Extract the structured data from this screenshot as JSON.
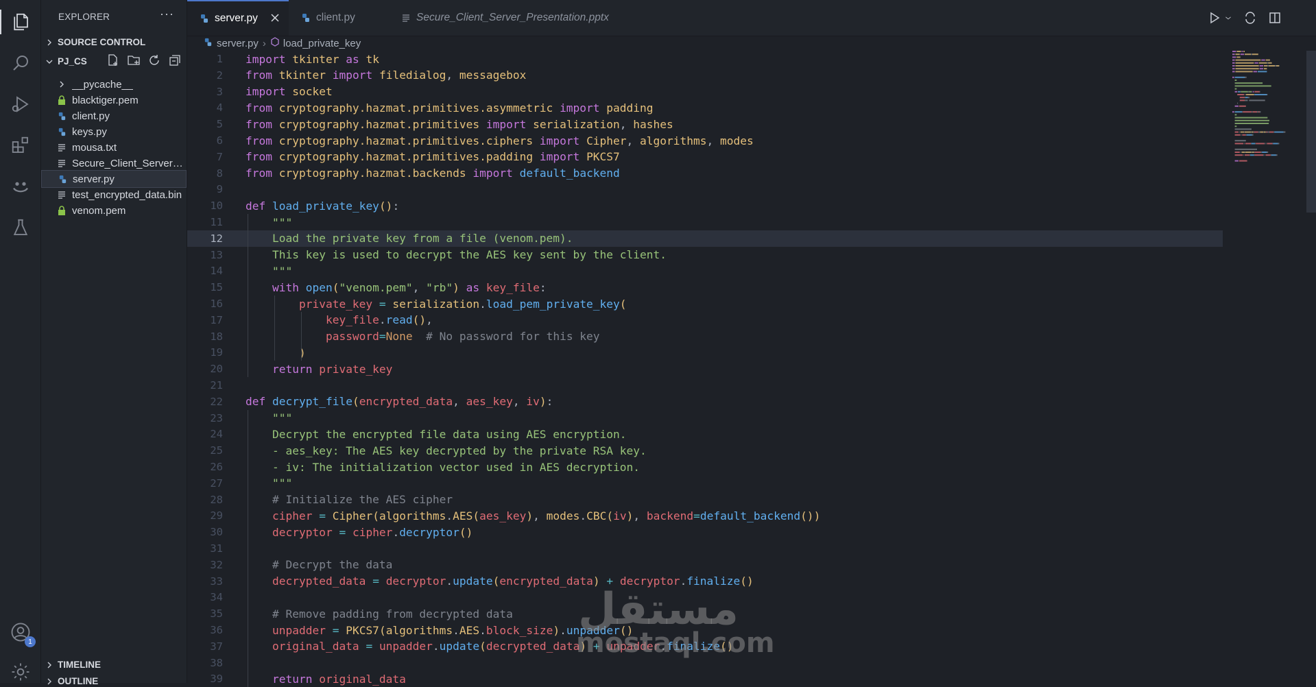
{
  "sidebar": {
    "header": "EXPLORER",
    "source_control": "SOURCE CONTROL",
    "project": "PJ_CS",
    "files": [
      {
        "name": "__pycache__",
        "icon": "chevron-right-icon"
      },
      {
        "name": "blacktiger.pem",
        "icon": "lock-icon"
      },
      {
        "name": "client.py",
        "icon": "python-icon"
      },
      {
        "name": "keys.py",
        "icon": "python-icon"
      },
      {
        "name": "mousa.txt",
        "icon": "text-file-icon"
      },
      {
        "name": "Secure_Client_Server_...",
        "icon": "text-file-icon"
      },
      {
        "name": "server.py",
        "icon": "python-icon"
      },
      {
        "name": "test_encrypted_data.bin",
        "icon": "text-file-icon"
      },
      {
        "name": "venom.pem",
        "icon": "lock-icon"
      }
    ],
    "timeline": "TIMELINE",
    "outline": "OUTLINE"
  },
  "tabs": [
    {
      "label": "server.py"
    },
    {
      "label": "client.py"
    },
    {
      "label": "Secure_Client_Server_Presentation.pptx"
    }
  ],
  "breadcrumb": {
    "file": "server.py",
    "symbol": "load_private_key"
  },
  "accounts_badge": "1",
  "watermark": {
    "arabic": "مستقل",
    "latin": "mostaql.com"
  },
  "colors": {
    "accent": "#4d78cc",
    "keyword": "#c678dd",
    "function": "#61afef",
    "string": "#98c379",
    "variable": "#e06c75",
    "type": "#e5c07b",
    "comment": "#7f848e"
  },
  "editor": {
    "current_line": 12,
    "lines": [
      {
        "n": "1",
        "t": [
          [
            "k",
            "import"
          ],
          [
            "p",
            " "
          ],
          [
            "t",
            "tkinter"
          ],
          [
            "p",
            " "
          ],
          [
            "k",
            "as"
          ],
          [
            "p",
            " "
          ],
          [
            "t",
            "tk"
          ]
        ]
      },
      {
        "n": "2",
        "t": [
          [
            "k",
            "from"
          ],
          [
            "p",
            " "
          ],
          [
            "t",
            "tkinter"
          ],
          [
            "p",
            " "
          ],
          [
            "k",
            "import"
          ],
          [
            "p",
            " "
          ],
          [
            "t",
            "filedialog"
          ],
          [
            "p",
            ", "
          ],
          [
            "t",
            "messagebox"
          ]
        ]
      },
      {
        "n": "3",
        "t": [
          [
            "k",
            "import"
          ],
          [
            "p",
            " "
          ],
          [
            "t",
            "socket"
          ]
        ]
      },
      {
        "n": "4",
        "t": [
          [
            "k",
            "from"
          ],
          [
            "p",
            " "
          ],
          [
            "t",
            "cryptography.hazmat.primitives.asymmetric"
          ],
          [
            "p",
            " "
          ],
          [
            "k",
            "import"
          ],
          [
            "p",
            " "
          ],
          [
            "t",
            "padding"
          ]
        ]
      },
      {
        "n": "5",
        "t": [
          [
            "k",
            "from"
          ],
          [
            "p",
            " "
          ],
          [
            "t",
            "cryptography.hazmat.primitives"
          ],
          [
            "p",
            " "
          ],
          [
            "k",
            "import"
          ],
          [
            "p",
            " "
          ],
          [
            "t",
            "serialization"
          ],
          [
            "p",
            ", "
          ],
          [
            "t",
            "hashes"
          ]
        ]
      },
      {
        "n": "6",
        "t": [
          [
            "k",
            "from"
          ],
          [
            "p",
            " "
          ],
          [
            "t",
            "cryptography.hazmat.primitives.ciphers"
          ],
          [
            "p",
            " "
          ],
          [
            "k",
            "import"
          ],
          [
            "p",
            " "
          ],
          [
            "t",
            "Cipher"
          ],
          [
            "p",
            ", "
          ],
          [
            "t",
            "algorithms"
          ],
          [
            "p",
            ", "
          ],
          [
            "t",
            "modes"
          ]
        ]
      },
      {
        "n": "7",
        "t": [
          [
            "k",
            "from"
          ],
          [
            "p",
            " "
          ],
          [
            "t",
            "cryptography.hazmat.primitives.padding"
          ],
          [
            "p",
            " "
          ],
          [
            "k",
            "import"
          ],
          [
            "p",
            " "
          ],
          [
            "t",
            "PKCS7"
          ]
        ]
      },
      {
        "n": "8",
        "t": [
          [
            "k",
            "from"
          ],
          [
            "p",
            " "
          ],
          [
            "t",
            "cryptography.hazmat.backends"
          ],
          [
            "p",
            " "
          ],
          [
            "k",
            "import"
          ],
          [
            "p",
            " "
          ],
          [
            "f",
            "default_backend"
          ]
        ]
      },
      {
        "n": "9",
        "t": []
      },
      {
        "n": "10",
        "t": [
          [
            "k",
            "def"
          ],
          [
            "p",
            " "
          ],
          [
            "f",
            "load_private_key"
          ],
          [
            "b",
            "()"
          ],
          [
            "p",
            ":"
          ]
        ]
      },
      {
        "n": "11",
        "t": [
          [
            "p",
            "    "
          ],
          [
            "s",
            "\"\"\""
          ]
        ]
      },
      {
        "n": "12",
        "t": [
          [
            "p",
            "    "
          ],
          [
            "s",
            "Load the private key from a file (venom.pem)."
          ]
        ]
      },
      {
        "n": "13",
        "t": [
          [
            "p",
            "    "
          ],
          [
            "s",
            "This key is used to decrypt the AES key sent by the client."
          ]
        ]
      },
      {
        "n": "14",
        "t": [
          [
            "p",
            "    "
          ],
          [
            "s",
            "\"\"\""
          ]
        ]
      },
      {
        "n": "15",
        "t": [
          [
            "p",
            "    "
          ],
          [
            "k",
            "with"
          ],
          [
            "p",
            " "
          ],
          [
            "f",
            "open"
          ],
          [
            "b",
            "("
          ],
          [
            "s",
            "\"venom.pem\""
          ],
          [
            "p",
            ", "
          ],
          [
            "s",
            "\"rb\""
          ],
          [
            "b",
            ")"
          ],
          [
            "p",
            " "
          ],
          [
            "k",
            "as"
          ],
          [
            "p",
            " "
          ],
          [
            "v",
            "key_file"
          ],
          [
            "p",
            ":"
          ]
        ]
      },
      {
        "n": "16",
        "t": [
          [
            "p",
            "        "
          ],
          [
            "v",
            "private_key"
          ],
          [
            "p",
            " "
          ],
          [
            "o",
            "="
          ],
          [
            "p",
            " "
          ],
          [
            "t",
            "serialization"
          ],
          [
            "p",
            "."
          ],
          [
            "f",
            "load_pem_private_key"
          ],
          [
            "b",
            "("
          ]
        ]
      },
      {
        "n": "17",
        "t": [
          [
            "p",
            "            "
          ],
          [
            "v",
            "key_file"
          ],
          [
            "p",
            "."
          ],
          [
            "f",
            "read"
          ],
          [
            "b",
            "()"
          ],
          [
            "p",
            ","
          ]
        ]
      },
      {
        "n": "18",
        "t": [
          [
            "p",
            "            "
          ],
          [
            "v",
            "password"
          ],
          [
            "o",
            "="
          ],
          [
            "y",
            "None"
          ],
          [
            "p",
            "  "
          ],
          [
            "c",
            "# No password for this key"
          ]
        ]
      },
      {
        "n": "19",
        "t": [
          [
            "p",
            "        "
          ],
          [
            "b",
            ")"
          ]
        ]
      },
      {
        "n": "20",
        "t": [
          [
            "p",
            "    "
          ],
          [
            "k",
            "return"
          ],
          [
            "p",
            " "
          ],
          [
            "v",
            "private_key"
          ]
        ]
      },
      {
        "n": "21",
        "t": []
      },
      {
        "n": "22",
        "t": [
          [
            "k",
            "def"
          ],
          [
            "p",
            " "
          ],
          [
            "f",
            "decrypt_file"
          ],
          [
            "b",
            "("
          ],
          [
            "v",
            "encrypted_data"
          ],
          [
            "p",
            ", "
          ],
          [
            "v",
            "aes_key"
          ],
          [
            "p",
            ", "
          ],
          [
            "v",
            "iv"
          ],
          [
            "b",
            ")"
          ],
          [
            "p",
            ":"
          ]
        ]
      },
      {
        "n": "23",
        "t": [
          [
            "p",
            "    "
          ],
          [
            "s",
            "\"\"\""
          ]
        ]
      },
      {
        "n": "24",
        "t": [
          [
            "p",
            "    "
          ],
          [
            "s",
            "Decrypt the encrypted file data using AES encryption."
          ]
        ]
      },
      {
        "n": "25",
        "t": [
          [
            "p",
            "    "
          ],
          [
            "s",
            "- aes_key: The AES key decrypted by the private RSA key."
          ]
        ]
      },
      {
        "n": "26",
        "t": [
          [
            "p",
            "    "
          ],
          [
            "s",
            "- iv: The initialization vector used in AES decryption."
          ]
        ]
      },
      {
        "n": "27",
        "t": [
          [
            "p",
            "    "
          ],
          [
            "s",
            "\"\"\""
          ]
        ]
      },
      {
        "n": "28",
        "t": [
          [
            "p",
            "    "
          ],
          [
            "c",
            "# Initialize the AES cipher"
          ]
        ]
      },
      {
        "n": "29",
        "t": [
          [
            "p",
            "    "
          ],
          [
            "v",
            "cipher"
          ],
          [
            "p",
            " "
          ],
          [
            "o",
            "="
          ],
          [
            "p",
            " "
          ],
          [
            "t",
            "Cipher"
          ],
          [
            "b",
            "("
          ],
          [
            "t",
            "algorithms"
          ],
          [
            "p",
            "."
          ],
          [
            "t",
            "AES"
          ],
          [
            "b",
            "("
          ],
          [
            "v",
            "aes_key"
          ],
          [
            "b",
            ")"
          ],
          [
            "p",
            ", "
          ],
          [
            "t",
            "modes"
          ],
          [
            "p",
            "."
          ],
          [
            "t",
            "CBC"
          ],
          [
            "b",
            "("
          ],
          [
            "v",
            "iv"
          ],
          [
            "b",
            ")"
          ],
          [
            "p",
            ", "
          ],
          [
            "v",
            "backend"
          ],
          [
            "o",
            "="
          ],
          [
            "f",
            "default_backend"
          ],
          [
            "b",
            "()"
          ],
          [
            "b",
            ")"
          ]
        ]
      },
      {
        "n": "30",
        "t": [
          [
            "p",
            "    "
          ],
          [
            "v",
            "decryptor"
          ],
          [
            "p",
            " "
          ],
          [
            "o",
            "="
          ],
          [
            "p",
            " "
          ],
          [
            "v",
            "cipher"
          ],
          [
            "p",
            "."
          ],
          [
            "f",
            "decryptor"
          ],
          [
            "b",
            "()"
          ]
        ]
      },
      {
        "n": "31",
        "t": []
      },
      {
        "n": "32",
        "t": [
          [
            "p",
            "    "
          ],
          [
            "c",
            "# Decrypt the data"
          ]
        ]
      },
      {
        "n": "33",
        "t": [
          [
            "p",
            "    "
          ],
          [
            "v",
            "decrypted_data"
          ],
          [
            "p",
            " "
          ],
          [
            "o",
            "="
          ],
          [
            "p",
            " "
          ],
          [
            "v",
            "decryptor"
          ],
          [
            "p",
            "."
          ],
          [
            "f",
            "update"
          ],
          [
            "b",
            "("
          ],
          [
            "v",
            "encrypted_data"
          ],
          [
            "b",
            ")"
          ],
          [
            "p",
            " "
          ],
          [
            "o",
            "+"
          ],
          [
            "p",
            " "
          ],
          [
            "v",
            "decryptor"
          ],
          [
            "p",
            "."
          ],
          [
            "f",
            "finalize"
          ],
          [
            "b",
            "()"
          ]
        ]
      },
      {
        "n": "34",
        "t": []
      },
      {
        "n": "35",
        "t": [
          [
            "p",
            "    "
          ],
          [
            "c",
            "# Remove padding from decrypted data"
          ]
        ]
      },
      {
        "n": "36",
        "t": [
          [
            "p",
            "    "
          ],
          [
            "v",
            "unpadder"
          ],
          [
            "p",
            " "
          ],
          [
            "o",
            "="
          ],
          [
            "p",
            " "
          ],
          [
            "t",
            "PKCS7"
          ],
          [
            "b",
            "("
          ],
          [
            "t",
            "algorithms"
          ],
          [
            "p",
            "."
          ],
          [
            "t",
            "AES"
          ],
          [
            "p",
            "."
          ],
          [
            "v",
            "block_size"
          ],
          [
            "b",
            ")"
          ],
          [
            "p",
            "."
          ],
          [
            "f",
            "unpadder"
          ],
          [
            "b",
            "()"
          ]
        ]
      },
      {
        "n": "37",
        "t": [
          [
            "p",
            "    "
          ],
          [
            "v",
            "original_data"
          ],
          [
            "p",
            " "
          ],
          [
            "o",
            "="
          ],
          [
            "p",
            " "
          ],
          [
            "v",
            "unpadder"
          ],
          [
            "p",
            "."
          ],
          [
            "f",
            "update"
          ],
          [
            "b",
            "("
          ],
          [
            "v",
            "decrypted_data"
          ],
          [
            "b",
            ")"
          ],
          [
            "p",
            " "
          ],
          [
            "o",
            "+"
          ],
          [
            "p",
            " "
          ],
          [
            "v",
            "unpadder"
          ],
          [
            "p",
            "."
          ],
          [
            "f",
            "finalize"
          ],
          [
            "b",
            "()"
          ]
        ]
      },
      {
        "n": "38",
        "t": []
      },
      {
        "n": "39",
        "t": [
          [
            "p",
            "    "
          ],
          [
            "k",
            "return"
          ],
          [
            "p",
            " "
          ],
          [
            "v",
            "original_data"
          ]
        ]
      }
    ]
  }
}
